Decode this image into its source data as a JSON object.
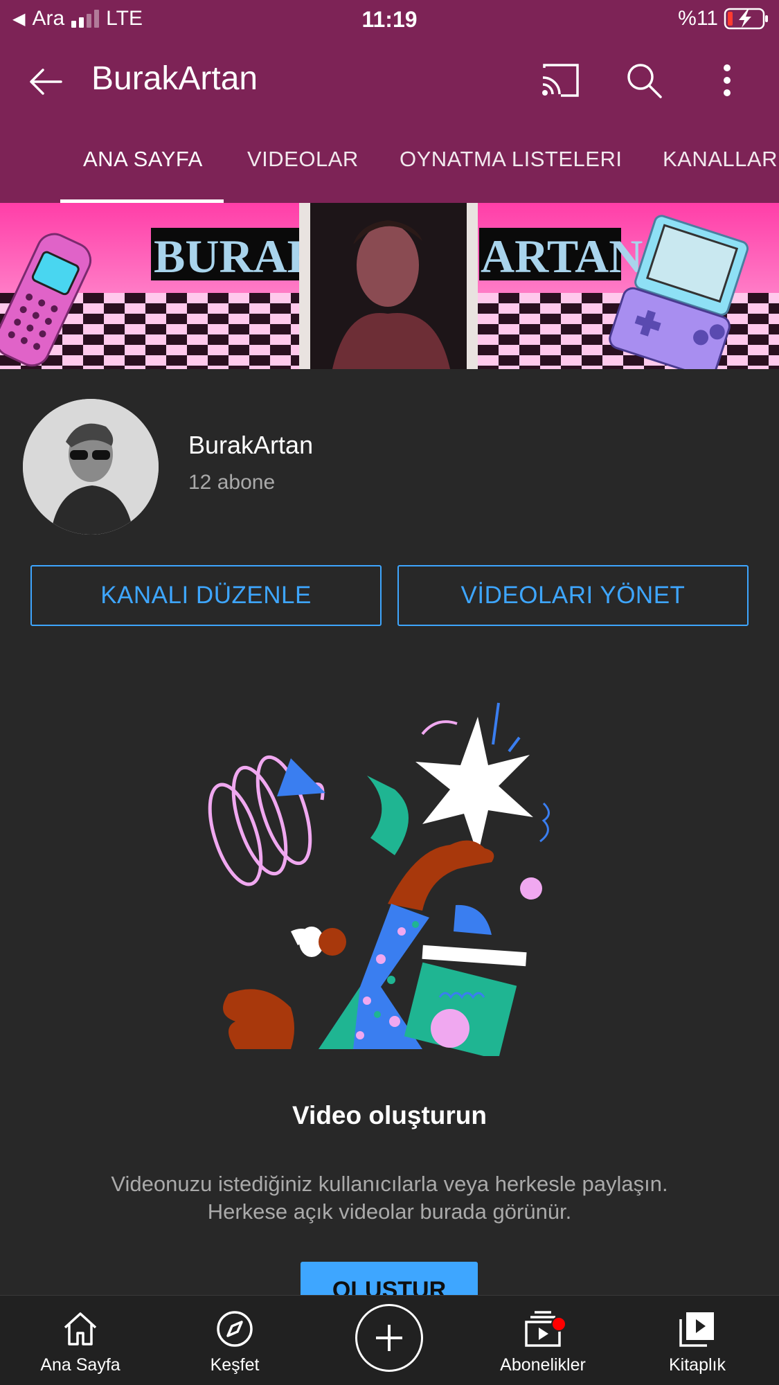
{
  "status_bar": {
    "back_app": "Ara",
    "network": "LTE",
    "time": "11:19",
    "battery": "%11"
  },
  "app_bar": {
    "title": "BurakArtan",
    "icons": [
      "back-arrow-icon",
      "cast-icon",
      "search-icon",
      "more-vert-icon"
    ]
  },
  "tabs": [
    {
      "label": "ANA SAYFA",
      "active": true
    },
    {
      "label": "VIDEOLAR",
      "active": false
    },
    {
      "label": "OYNATMA LISTELERI",
      "active": false
    },
    {
      "label": "KANALLAR",
      "active": false
    }
  ],
  "banner": {
    "left_word": "BURAK",
    "right_word": "ARTAN"
  },
  "channel": {
    "name": "BurakArtan",
    "subscribers": "12 abone"
  },
  "actions": {
    "edit_channel": "KANALI DÜZENLE",
    "manage_videos": "VİDEOLARI YÖNET"
  },
  "empty_state": {
    "title": "Video oluşturun",
    "line1": "Videonuzu istediğiniz kullanıcılarla veya herkesle paylaşın.",
    "line2": "Herkese açık videolar burada görünür.",
    "create_button": "OLUŞTUR"
  },
  "bottom_nav": [
    {
      "label": "Ana Sayfa",
      "icon": "home-icon"
    },
    {
      "label": "Keşfet",
      "icon": "explore-icon"
    },
    {
      "label": "",
      "icon": "add-icon"
    },
    {
      "label": "Abonelikler",
      "icon": "subscriptions-icon",
      "badge": true
    },
    {
      "label": "Kitaplık",
      "icon": "library-icon"
    }
  ],
  "colors": {
    "header": "#7d2356",
    "background": "#282828",
    "accent_blue": "#3ea6ff",
    "nav_background": "#212121",
    "badge_red": "#ff0000"
  }
}
